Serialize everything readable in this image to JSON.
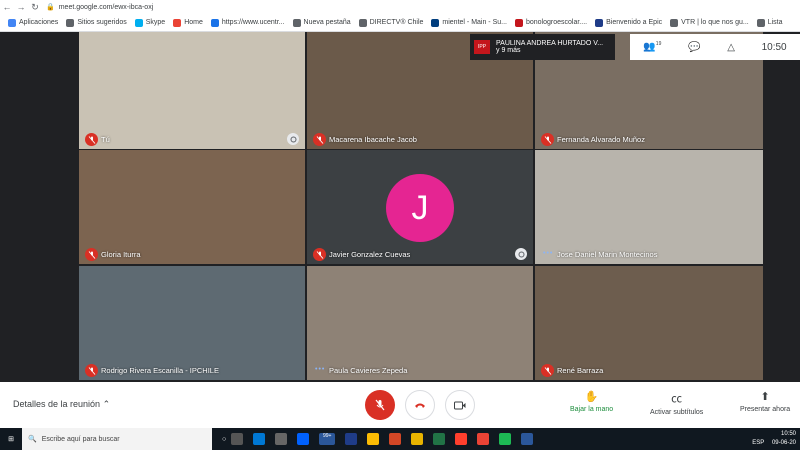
{
  "browser": {
    "url": "meet.google.com/ewx-ibca-oxj",
    "bookmarks": [
      {
        "label": "Aplicaciones",
        "color": "#4285f4"
      },
      {
        "label": "Sitios sugeridos",
        "color": "#5f6368"
      },
      {
        "label": "Skype",
        "color": "#00aff0"
      },
      {
        "label": "Home",
        "color": "#ea4335"
      },
      {
        "label": "https://www.ucentr...",
        "color": "#1a73e8"
      },
      {
        "label": "Nueva pestaña",
        "color": "#5f6368"
      },
      {
        "label": "DIRECTV® Chile",
        "color": "#5f6368"
      },
      {
        "label": "mientel - Main - Su...",
        "color": "#003e7e"
      },
      {
        "label": "bonologroescolar....",
        "color": "#c4161c"
      },
      {
        "label": "Bienvenido a Epic",
        "color": "#1f3c88"
      },
      {
        "label": "VTR | lo que nos gu...",
        "color": "#5f6368"
      },
      {
        "label": "Lista",
        "color": "#5f6368"
      }
    ]
  },
  "meet": {
    "presenter": {
      "logo": "IPP",
      "name": "PAULINA ANDREA HURTADO V...",
      "others": "y 9 más"
    },
    "participants_count": "19",
    "clock": "10:50",
    "avatar_letter": "J",
    "tiles": [
      {
        "name": "Tú",
        "bg": "#c9c2b4",
        "muted": true
      },
      {
        "name": "Macarena Ibacache Jacob",
        "bg": "#6b5a4a",
        "muted": true
      },
      {
        "name": "Fernanda Alvarado Muñoz",
        "bg": "#7a6e62",
        "muted": true
      },
      {
        "name": "Gloria Iturra",
        "bg": "#7c6450",
        "muted": true
      },
      {
        "name": "Javier Gonzalez Cuevas",
        "bg": "#3c4043",
        "muted": true
      },
      {
        "name": "Jose Daniel Marin Montecinos",
        "bg": "#b8b4ac",
        "muted": false
      },
      {
        "name": "Rodrigo Rivera Escanilla - IPCHILE",
        "bg": "#5e6a72",
        "muted": true
      },
      {
        "name": "Paula Cavieres Zepeda",
        "bg": "#8e8276",
        "muted": false
      },
      {
        "name": "René Barraza",
        "bg": "#6d5d4e",
        "muted": true
      }
    ],
    "details_label": "Detalles de la reunión",
    "actions": {
      "raise_hand": "Bajar la mano",
      "captions": "Activar subtítulos",
      "present": "Presentar ahora"
    }
  },
  "taskbar": {
    "search_placeholder": "Escribe aquí para buscar",
    "badge": "99+",
    "lang": "ESP",
    "time": "10:50",
    "date": "09-06-20"
  }
}
